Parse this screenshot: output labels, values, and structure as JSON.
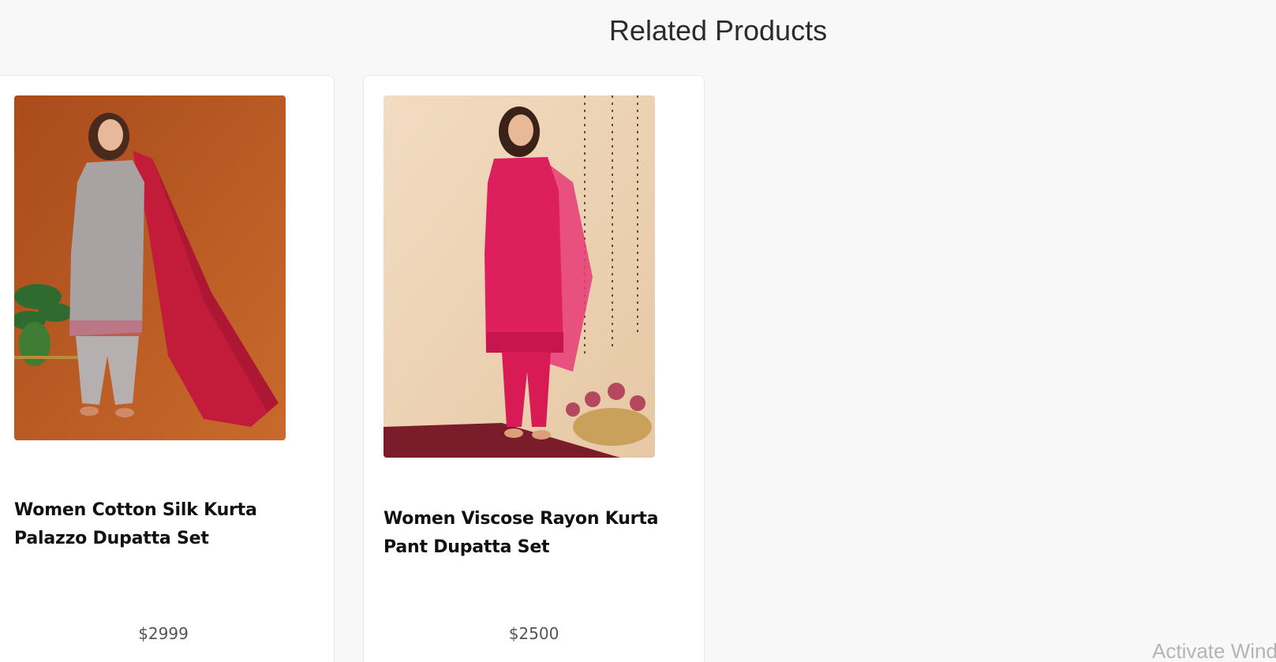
{
  "section": {
    "title": "Related Products"
  },
  "products": [
    {
      "title": "Women Cotton Silk Kurta Palazzo Dupatta Set",
      "price": "$2999",
      "image": {
        "background": "#b95a24",
        "outfit_color": "#a9a2a3",
        "dupatta_color": "#c21c3a"
      }
    },
    {
      "title": "Women Viscose Rayon Kurta Pant Dupatta Set",
      "price": "$2500",
      "image": {
        "background": "#efd6b8",
        "outfit_color": "#de1f5e",
        "dupatta_color": "#e83a76"
      }
    }
  ],
  "watermark": {
    "text": "Activate Windows"
  }
}
